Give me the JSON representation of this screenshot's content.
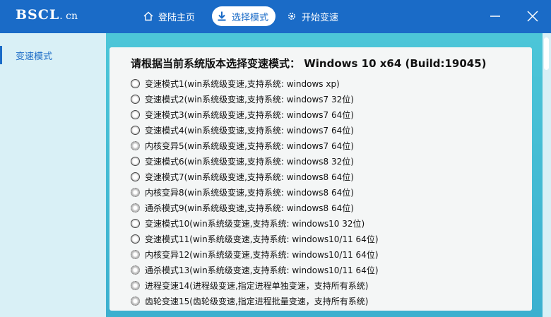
{
  "app": {
    "logo_main": "BSCL",
    "logo_suffix": ". cn"
  },
  "nav": {
    "home": "登陆主页",
    "mode": "选择模式",
    "start": "开始变速"
  },
  "sidebar": {
    "items": [
      {
        "label": "变速模式"
      }
    ]
  },
  "main": {
    "prompt": "请根据当前系统版本选择变速模式：   Windows 10  x64 (Build:19045)",
    "options": [
      {
        "label": "变速模式1(win系统级变速,支持系统: windows xp)",
        "icon": "radio-icon"
      },
      {
        "label": "变速模式2(win系统级变速,支持系统: windows7 32位)",
        "icon": "radio-icon"
      },
      {
        "label": "变速模式3(win系统级变速,支持系统: windows7 64位)",
        "icon": "radio-icon"
      },
      {
        "label": "变速模式4(win系统级变速,支持系统: windows7 64位)",
        "icon": "radio-icon"
      },
      {
        "label": "内核变异5(win系统级变速,支持系统: windows7 64位)",
        "icon": "gear-icon"
      },
      {
        "label": "变速模式6(win系统级变速,支持系统: windows8 32位)",
        "icon": "radio-icon"
      },
      {
        "label": "变速模式7(win系统级变速,支持系统: windows8 64位)",
        "icon": "radio-icon"
      },
      {
        "label": "内核变异8(win系统级变速,支持系统: windows8 64位)",
        "icon": "gear-icon"
      },
      {
        "label": "通杀模式9(win系统级变速,支持系统: windows8 64位)",
        "icon": "gear-icon"
      },
      {
        "label": "变速模式10(win系统级变速,支持系统: windows10 32位)",
        "icon": "radio-icon"
      },
      {
        "label": "变速模式11(win系统级变速,支持系统: windows10/11 64位)",
        "icon": "radio-icon"
      },
      {
        "label": "内核变异12(win系统级变速,支持系统: windows10/11 64位)",
        "icon": "gear-icon"
      },
      {
        "label": "通杀模式13(win系统级变速,支持系统: windows10/11 64位)",
        "icon": "gear-icon"
      },
      {
        "label": "进程变速14(进程级变速,指定进程单独变速，支持所有系统)",
        "icon": "gear-icon"
      },
      {
        "label": "齿轮变速15(齿轮级变速,指定进程批量变速，支持所有系统)",
        "icon": "gear-icon"
      }
    ]
  },
  "colors": {
    "titlebar": "#1a6bc7",
    "accent": "#1a6bc7",
    "panel": "#f4f6f6",
    "background": "#4ab6d2"
  }
}
